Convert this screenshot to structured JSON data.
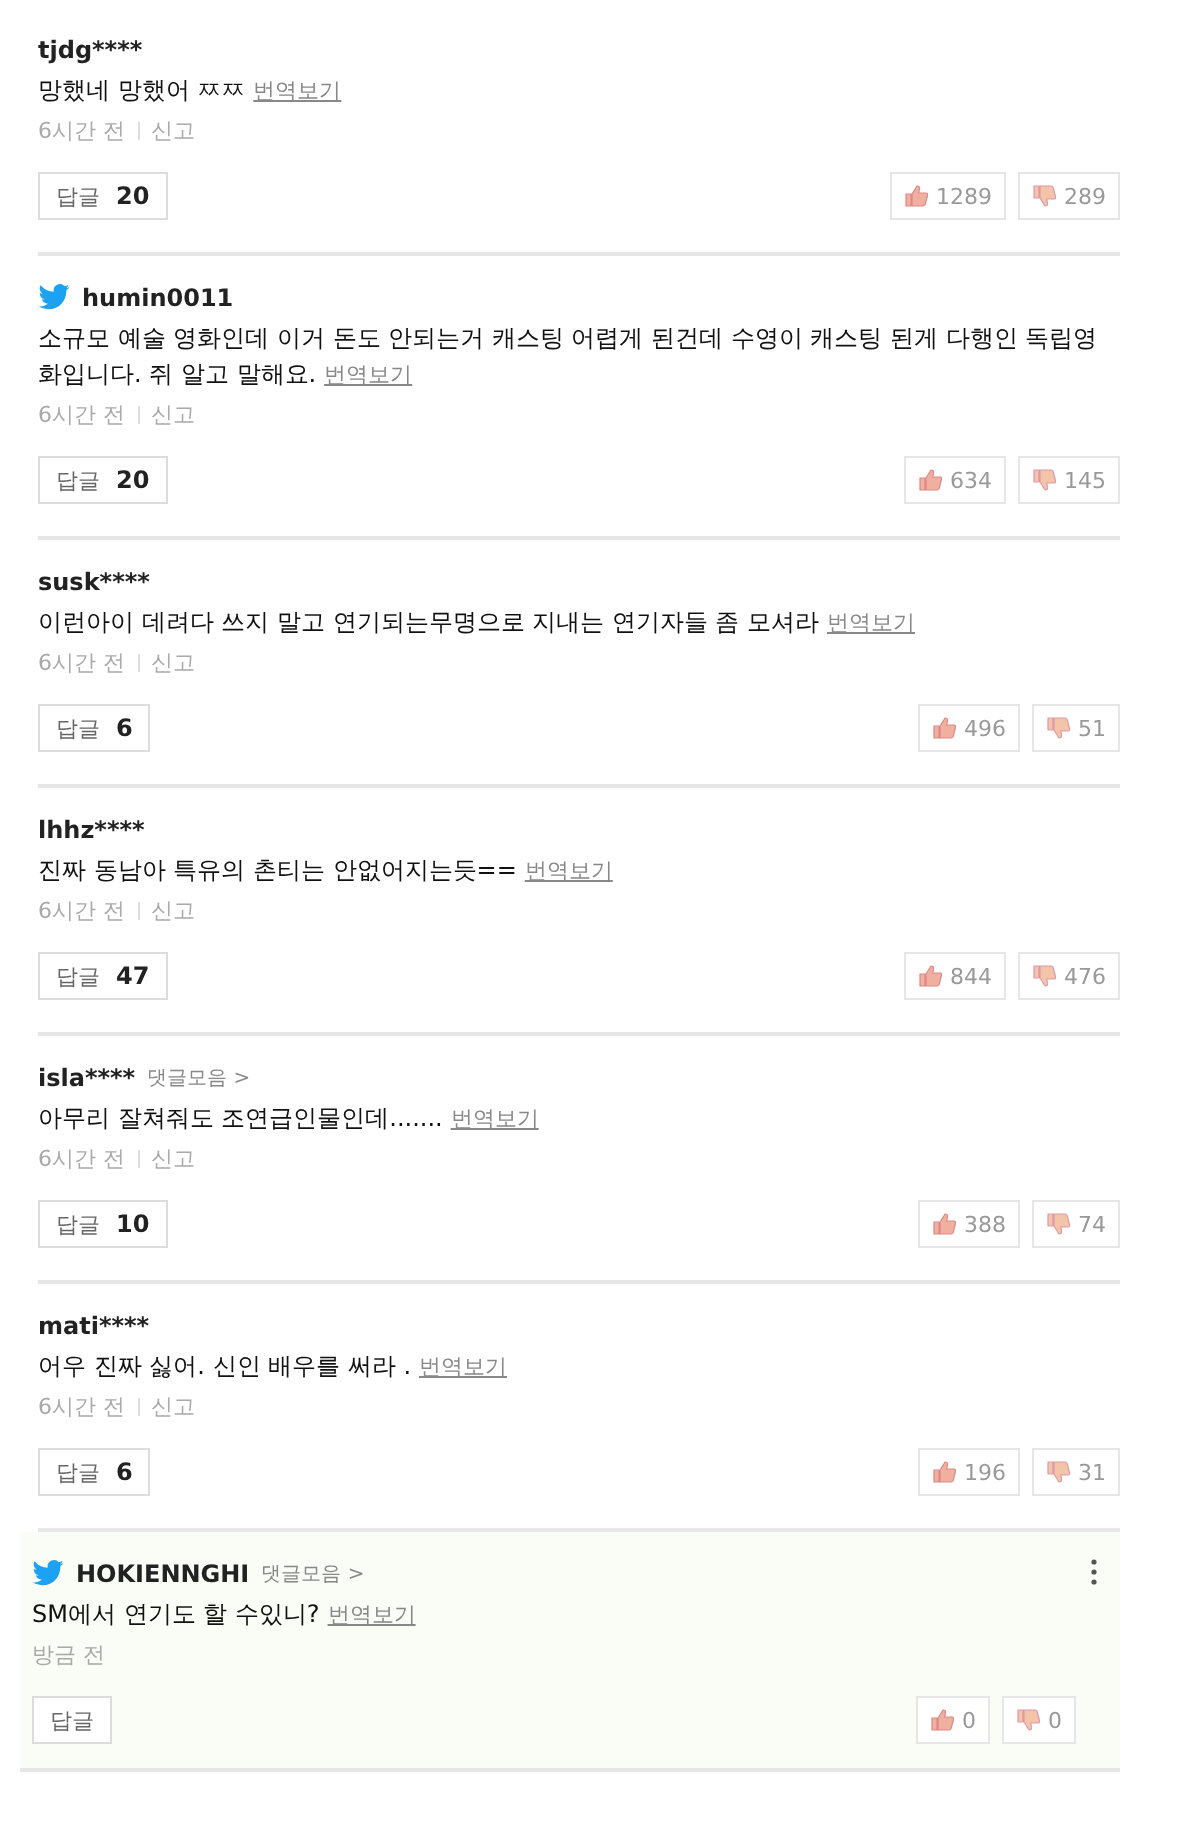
{
  "comments": [
    {
      "kind": "member",
      "author": "tjdg****",
      "text": "망했네 망했어 ㅉㅉ",
      "translate": "번역보기",
      "time": "6시간 전",
      "report": "신고",
      "reply_label": "답글",
      "reply_count": "20",
      "likes": "1289",
      "dislikes": "289",
      "highlighted": false,
      "menu": false
    },
    {
      "kind": "twitter",
      "author": "humin0011",
      "text": "소규모 예술 영화인데 이거 돈도 안되는거 캐스팅 어렵게 된건데 수영이 캐스팅 된게 다행인 독립영화입니다. 쥐 알고 말해요.",
      "translate": "번역보기",
      "time": "6시간 전",
      "report": "신고",
      "reply_label": "답글",
      "reply_count": "20",
      "likes": "634",
      "dislikes": "145",
      "highlighted": false,
      "menu": false
    },
    {
      "kind": "member",
      "author": "susk****",
      "text": "이런아이 데려다 쓰지 말고 연기되는무명으로 지내는 연기자들 좀 모셔라",
      "translate": "번역보기",
      "time": "6시간 전",
      "report": "신고",
      "reply_label": "답글",
      "reply_count": "6",
      "likes": "496",
      "dislikes": "51",
      "highlighted": false,
      "menu": false
    },
    {
      "kind": "member",
      "author": "lhhz****",
      "text": "진짜 동남아 특유의 촌티는 안없어지는듯==",
      "translate": "번역보기",
      "time": "6시간 전",
      "report": "신고",
      "reply_label": "답글",
      "reply_count": "47",
      "likes": "844",
      "dislikes": "476",
      "highlighted": false,
      "menu": false
    },
    {
      "kind": "member",
      "author": "isla****",
      "collection": "댓글모음 >",
      "text": "아무리 잘쳐줘도 조연급인물인데.......",
      "translate": "번역보기",
      "time": "6시간 전",
      "report": "신고",
      "reply_label": "답글",
      "reply_count": "10",
      "likes": "388",
      "dislikes": "74",
      "highlighted": false,
      "menu": false
    },
    {
      "kind": "member",
      "author": "mati****",
      "text": "어우 진짜 싫어. 신인 배우를 써라 .",
      "translate": "번역보기",
      "time": "6시간 전",
      "report": "신고",
      "reply_label": "답글",
      "reply_count": "6",
      "likes": "196",
      "dislikes": "31",
      "highlighted": false,
      "menu": false
    },
    {
      "kind": "twitter",
      "author": "HOKIENNGHI",
      "collection": "댓글모음 >",
      "text": "SM에서 연기도 할 수있니?",
      "translate": "번역보기",
      "time": "방금 전",
      "reply_label": "답글",
      "likes": "0",
      "dislikes": "0",
      "highlighted": true,
      "menu": true
    }
  ]
}
